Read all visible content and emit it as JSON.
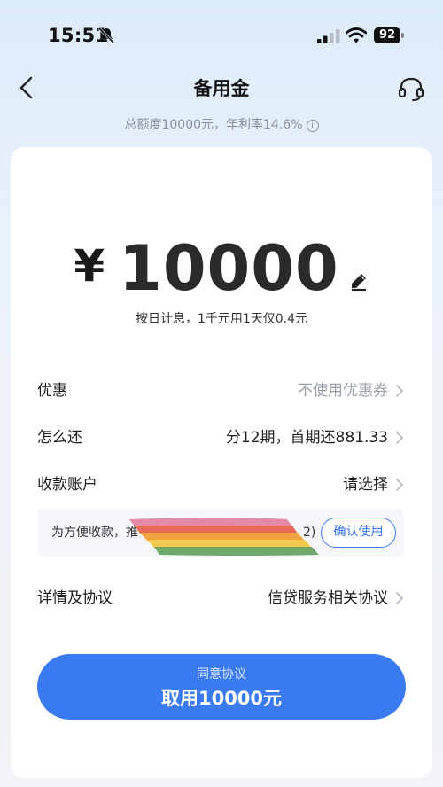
{
  "status_bar": {
    "time": "15:51",
    "battery": "92",
    "icons": [
      "bell-muted-icon",
      "signal-icon",
      "wifi-icon",
      "battery-icon"
    ]
  },
  "nav": {
    "title": "备用金",
    "icons": [
      "back-arrow-icon",
      "headset-icon"
    ]
  },
  "quota": {
    "text": "总额度10000元，年利率14.6%",
    "icon": "info-icon"
  },
  "amount": {
    "currency": "¥",
    "value": "10000",
    "icon": "edit-pencil-icon",
    "interest_note": "按日计息，1千元用1天仅0.4元"
  },
  "rows": [
    {
      "label": "优惠",
      "value": "不使用优惠券"
    },
    {
      "label": "怎么还",
      "value": "分12期，首期还881.33"
    },
    {
      "label": "收款账户",
      "value": "请选择"
    }
  ],
  "notice": {
    "text": "为方便收款，推",
    "text_tail": "2)",
    "button": "确认使用"
  },
  "agreement_row": {
    "label": "详情及协议",
    "value": "信贷服务相关协议"
  },
  "cta": {
    "sub": "同意协议",
    "main": "取用10000元"
  },
  "colors": {
    "primary": "#3a7bf2",
    "muted_text": "#9aa0a8",
    "background": "#f1f3f6"
  }
}
